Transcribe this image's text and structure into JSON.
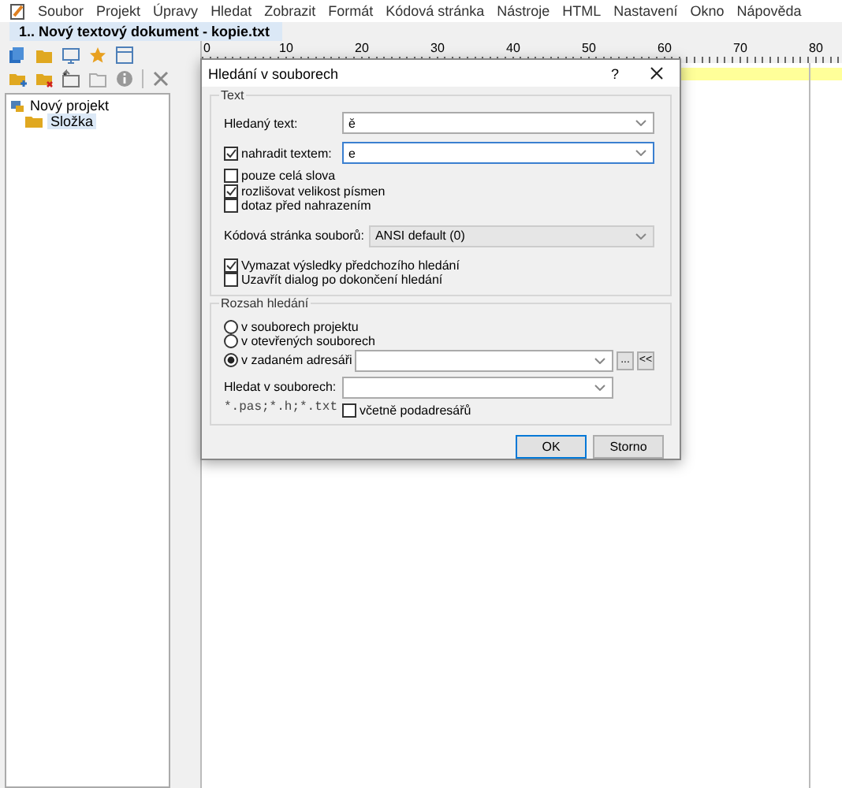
{
  "menu": [
    "Soubor",
    "Projekt",
    "Úpravy",
    "Hledat",
    "Zobrazit",
    "Formát",
    "Kódová stránka",
    "Nástroje",
    "HTML",
    "Nastavení",
    "Okno",
    "Nápověda"
  ],
  "document_tabs": [
    {
      "label": "1.. Nový textový dokument - kopie.txt",
      "selected": true
    }
  ],
  "sidebar": {
    "tree": [
      {
        "label": "Nový projekt",
        "selected": false,
        "children": [
          {
            "label": "Složka",
            "selected": true
          }
        ]
      }
    ]
  },
  "ruler": {
    "labels": [
      "0",
      "10",
      "20",
      "30",
      "40",
      "50",
      "60",
      "70",
      "80"
    ]
  },
  "dialog": {
    "title": "Hledání v souborech",
    "help_button": "?",
    "text_group": {
      "title": "Text",
      "search": {
        "label": "Hledaný text:",
        "value": "ě"
      },
      "replace": {
        "label": "nahradit textem:",
        "checked": true,
        "value": "e"
      },
      "options": [
        {
          "label": "pouze celá slova",
          "checked": false
        },
        {
          "label": "rozlišovat velikost písmen",
          "checked": true
        },
        {
          "label": "dotaz před nahrazením",
          "checked": false
        }
      ],
      "codepage": {
        "label": "Kódová stránka souborů:",
        "value": "ANSI default (0)"
      },
      "after_options": [
        {
          "label": "Vymazat výsledky předchozího hledání",
          "checked": true
        },
        {
          "label": "Uzavřít dialog po dokončení hledání",
          "checked": false
        }
      ]
    },
    "scope_group": {
      "title": "Rozsah hledání",
      "scopes": [
        {
          "label": "v souborech projektu",
          "selected": false
        },
        {
          "label": "v otevřených souborech",
          "selected": false
        },
        {
          "label": "v zadaném adresáři",
          "selected": true
        }
      ],
      "browse_button": "...",
      "collapse_button": "<<",
      "mask": {
        "label": "Hledat v souborech:",
        "hint": "*.pas;*.h;*.txt"
      },
      "subdirs": {
        "label": "včetně podadresářů",
        "checked": false
      }
    },
    "buttons": [
      {
        "label": "OK",
        "default": true
      },
      {
        "label": "Storno",
        "default": false
      }
    ]
  }
}
